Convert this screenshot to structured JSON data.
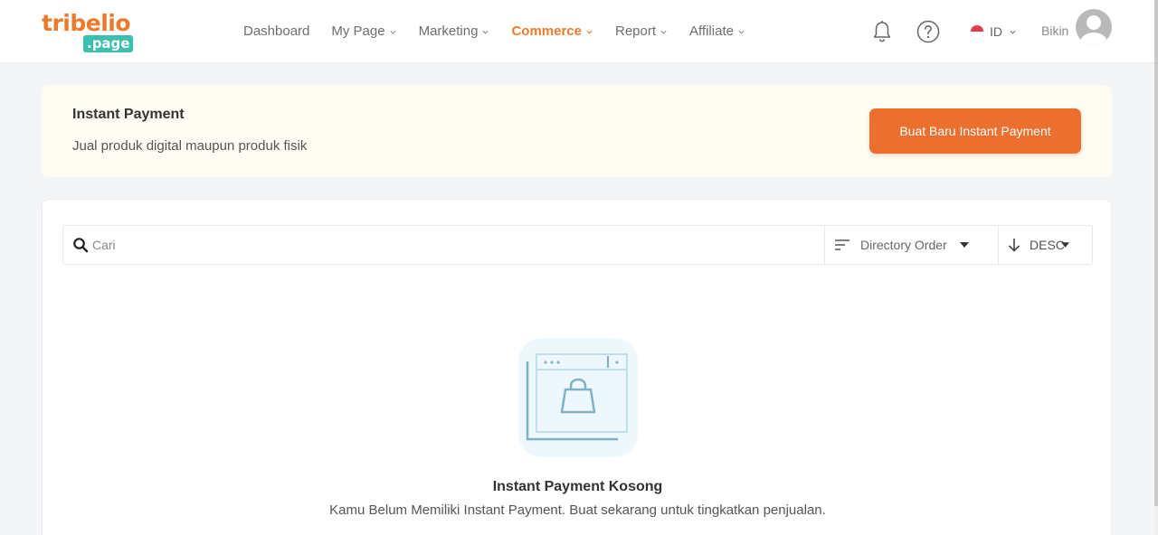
{
  "logo": {
    "top": "tribelio",
    "bottom": ".page"
  },
  "nav": {
    "items": [
      {
        "label": "Dashboard",
        "has_dropdown": false
      },
      {
        "label": "My Page",
        "has_dropdown": true
      },
      {
        "label": "Marketing",
        "has_dropdown": true
      },
      {
        "label": "Commerce",
        "has_dropdown": true,
        "active": true
      },
      {
        "label": "Report",
        "has_dropdown": true
      },
      {
        "label": "Affiliate",
        "has_dropdown": true
      }
    ]
  },
  "header": {
    "language": "ID",
    "user_name": "Bikin",
    "icons": [
      "bell-icon",
      "help-icon",
      "flag-icon",
      "avatar-icon"
    ]
  },
  "banner": {
    "title": "Instant Payment",
    "subtitle": "Jual produk digital maupun produk fisik",
    "create_button": "Buat Baru Instant Payment"
  },
  "toolbar": {
    "search_placeholder": "Cari",
    "sort_label": "Directory Order",
    "direction_label": "DESC"
  },
  "empty_state": {
    "title": "Instant Payment Kosong",
    "description": "Kamu Belum Memiliki Instant Payment. Buat sekarang untuk tingkatkan penjualan."
  },
  "colors": {
    "accent": "#ec7a2b",
    "button": "#ec6f2f",
    "logo_badge": "#3cbfae",
    "banner_bg": "#fefcf3",
    "page_bg": "#f4f5f7"
  }
}
